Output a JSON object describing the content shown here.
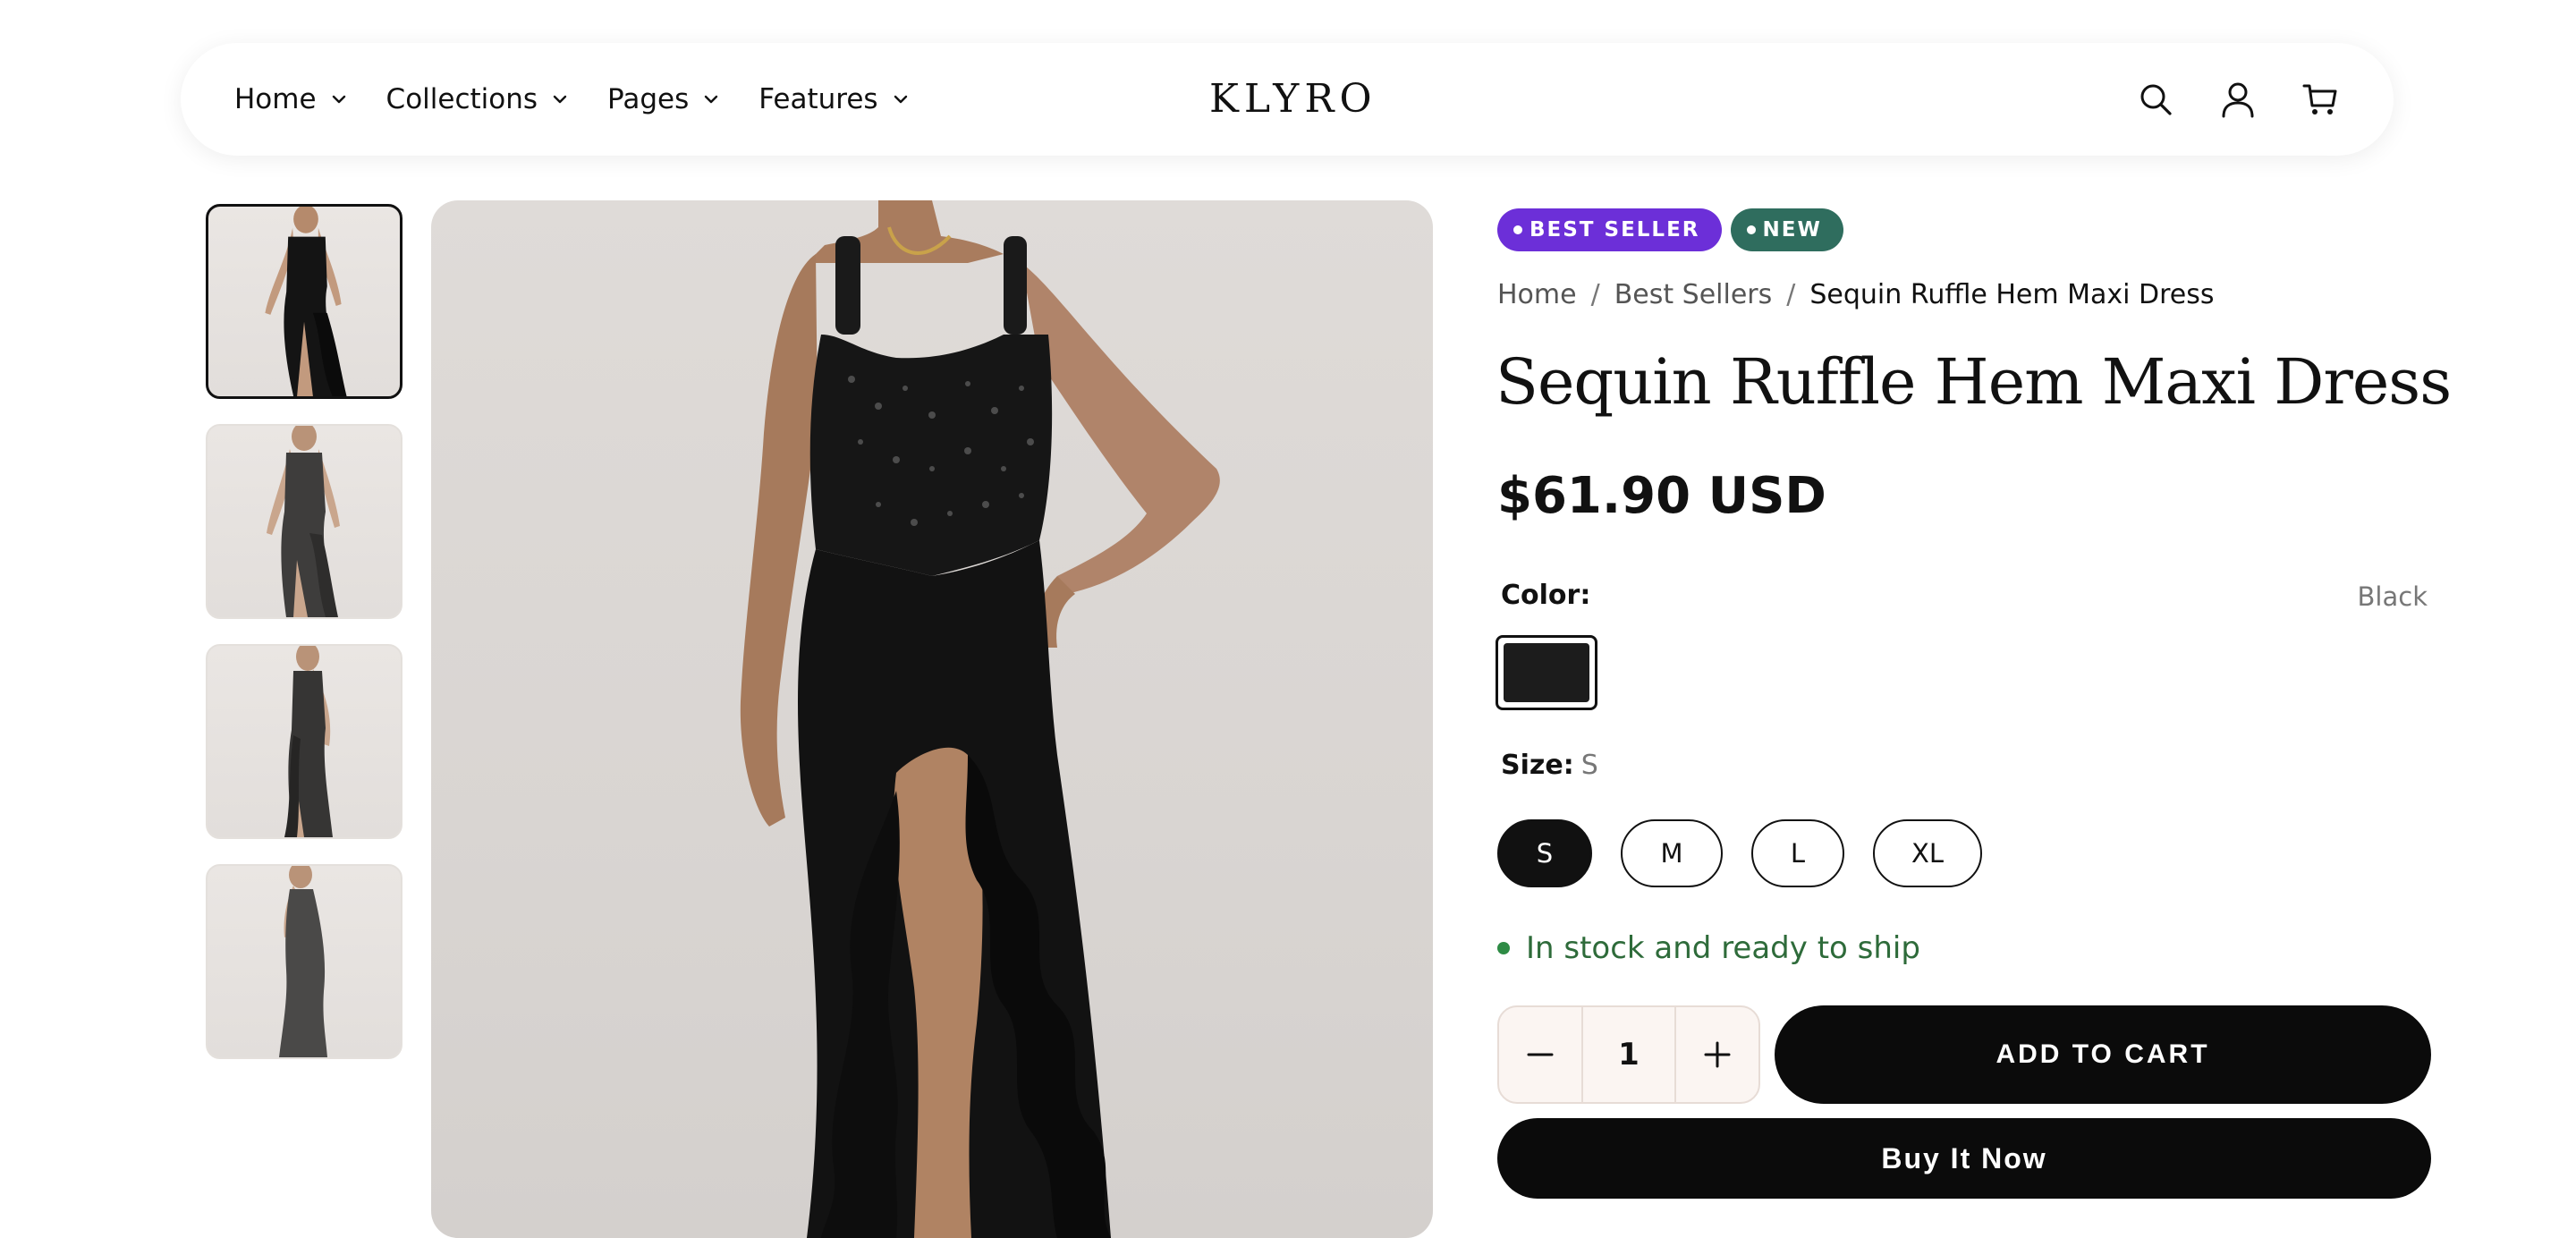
{
  "nav": {
    "items": [
      {
        "label": "Home",
        "icon": "chevron-down-icon"
      },
      {
        "label": "Collections",
        "icon": "chevron-down-icon"
      },
      {
        "label": "Pages",
        "icon": "chevron-down-icon"
      },
      {
        "label": "Features",
        "icon": "chevron-down-icon"
      }
    ]
  },
  "brand": {
    "logo": "KLYRO"
  },
  "header_icons": [
    "search-icon",
    "account-icon",
    "cart-icon"
  ],
  "gallery": {
    "thumbnail_count": 4,
    "active_index": 0,
    "image_subject": "black sequin ruffle hem maxi dress"
  },
  "product": {
    "badges": [
      {
        "label": "BEST SELLER",
        "color": "#6c2fd8"
      },
      {
        "label": "NEW",
        "color": "#2f6d5e"
      }
    ],
    "breadcrumb": {
      "home": "Home",
      "sep": "/",
      "category": "Best Sellers",
      "current": "Sequin Ruffle Hem Maxi Dress"
    },
    "title": "Sequin Ruffle Hem Maxi Dress",
    "price": "$61.90 USD",
    "color": {
      "label": "Color:",
      "selected": "Black",
      "swatch_hex": "#1c1c1c"
    },
    "size": {
      "label": "Size:",
      "selected": "S",
      "options": [
        "S",
        "M",
        "L",
        "XL"
      ]
    },
    "stock_status": "In stock and ready to ship",
    "quantity": "1",
    "add_to_cart_label": "ADD TO CART",
    "buy_now_label": "Buy It Now"
  }
}
